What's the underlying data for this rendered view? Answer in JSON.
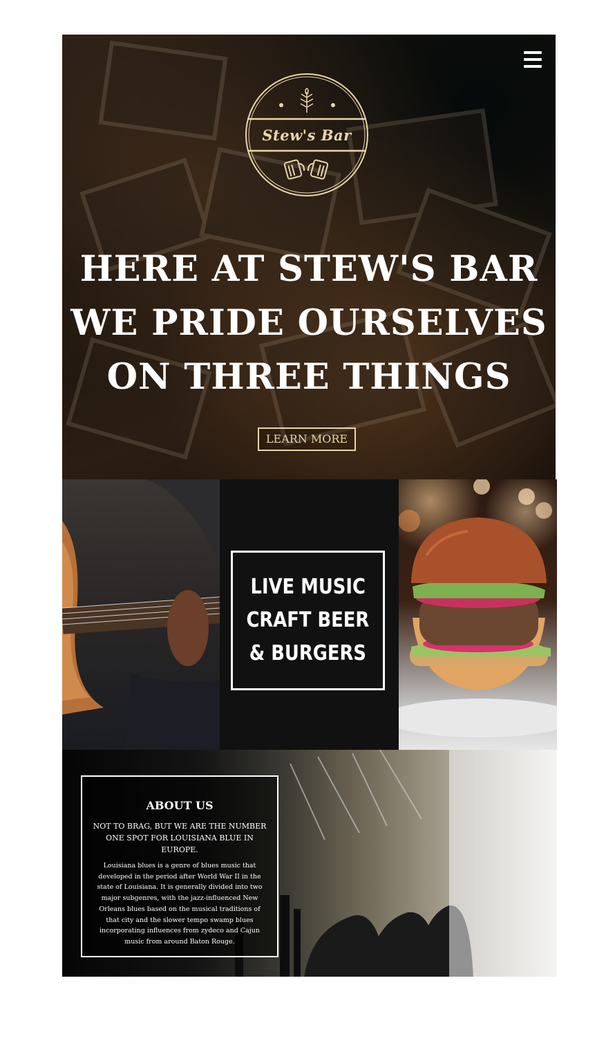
{
  "hero": {
    "logo_name": "Stew's Bar",
    "headline_lines": [
      "HERE AT STEW'S BAR",
      "WE PRIDE OURSELVES",
      "ON THREE THINGS"
    ],
    "button_label": "LEARN MORE",
    "menu_icon": "hamburger-icon",
    "logo_icons": [
      "wheat-icon",
      "beer-mugs-icon"
    ]
  },
  "features": {
    "lines": [
      "LIVE MUSIC",
      "CRAFT BEER",
      "& BURGERS"
    ]
  },
  "about": {
    "title": "ABOUT US",
    "subtitle": "NOT TO BRAG, BUT WE ARE THE NUMBER ONE SPOT FOR LOUISIANA BLUE IN EUROPE.",
    "body": "Louisiana blues is a genre of blues music that developed in the period after World War II in the state of Louisiana. It is generally divided into two major subgenres, with the jazz-influenced New Orleans blues based on the musical traditions of that city and the slower tempo swamp blues incorporating influences from zydeco and Cajun music from around Baton Rouge."
  },
  "colors": {
    "accent_gold": "#e9d7a9",
    "dark": "#111111"
  }
}
